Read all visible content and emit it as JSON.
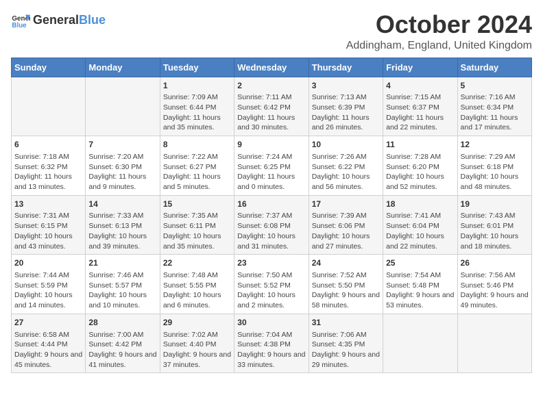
{
  "logo": {
    "general": "General",
    "blue": "Blue"
  },
  "title": {
    "month_year": "October 2024",
    "location": "Addingham, England, United Kingdom"
  },
  "days_header": [
    "Sunday",
    "Monday",
    "Tuesday",
    "Wednesday",
    "Thursday",
    "Friday",
    "Saturday"
  ],
  "weeks": [
    [
      {
        "day": "",
        "info": ""
      },
      {
        "day": "",
        "info": ""
      },
      {
        "day": "1",
        "info": "Sunrise: 7:09 AM\nSunset: 6:44 PM\nDaylight: 11 hours and 35 minutes."
      },
      {
        "day": "2",
        "info": "Sunrise: 7:11 AM\nSunset: 6:42 PM\nDaylight: 11 hours and 30 minutes."
      },
      {
        "day": "3",
        "info": "Sunrise: 7:13 AM\nSunset: 6:39 PM\nDaylight: 11 hours and 26 minutes."
      },
      {
        "day": "4",
        "info": "Sunrise: 7:15 AM\nSunset: 6:37 PM\nDaylight: 11 hours and 22 minutes."
      },
      {
        "day": "5",
        "info": "Sunrise: 7:16 AM\nSunset: 6:34 PM\nDaylight: 11 hours and 17 minutes."
      }
    ],
    [
      {
        "day": "6",
        "info": "Sunrise: 7:18 AM\nSunset: 6:32 PM\nDaylight: 11 hours and 13 minutes."
      },
      {
        "day": "7",
        "info": "Sunrise: 7:20 AM\nSunset: 6:30 PM\nDaylight: 11 hours and 9 minutes."
      },
      {
        "day": "8",
        "info": "Sunrise: 7:22 AM\nSunset: 6:27 PM\nDaylight: 11 hours and 5 minutes."
      },
      {
        "day": "9",
        "info": "Sunrise: 7:24 AM\nSunset: 6:25 PM\nDaylight: 11 hours and 0 minutes."
      },
      {
        "day": "10",
        "info": "Sunrise: 7:26 AM\nSunset: 6:22 PM\nDaylight: 10 hours and 56 minutes."
      },
      {
        "day": "11",
        "info": "Sunrise: 7:28 AM\nSunset: 6:20 PM\nDaylight: 10 hours and 52 minutes."
      },
      {
        "day": "12",
        "info": "Sunrise: 7:29 AM\nSunset: 6:18 PM\nDaylight: 10 hours and 48 minutes."
      }
    ],
    [
      {
        "day": "13",
        "info": "Sunrise: 7:31 AM\nSunset: 6:15 PM\nDaylight: 10 hours and 43 minutes."
      },
      {
        "day": "14",
        "info": "Sunrise: 7:33 AM\nSunset: 6:13 PM\nDaylight: 10 hours and 39 minutes."
      },
      {
        "day": "15",
        "info": "Sunrise: 7:35 AM\nSunset: 6:11 PM\nDaylight: 10 hours and 35 minutes."
      },
      {
        "day": "16",
        "info": "Sunrise: 7:37 AM\nSunset: 6:08 PM\nDaylight: 10 hours and 31 minutes."
      },
      {
        "day": "17",
        "info": "Sunrise: 7:39 AM\nSunset: 6:06 PM\nDaylight: 10 hours and 27 minutes."
      },
      {
        "day": "18",
        "info": "Sunrise: 7:41 AM\nSunset: 6:04 PM\nDaylight: 10 hours and 22 minutes."
      },
      {
        "day": "19",
        "info": "Sunrise: 7:43 AM\nSunset: 6:01 PM\nDaylight: 10 hours and 18 minutes."
      }
    ],
    [
      {
        "day": "20",
        "info": "Sunrise: 7:44 AM\nSunset: 5:59 PM\nDaylight: 10 hours and 14 minutes."
      },
      {
        "day": "21",
        "info": "Sunrise: 7:46 AM\nSunset: 5:57 PM\nDaylight: 10 hours and 10 minutes."
      },
      {
        "day": "22",
        "info": "Sunrise: 7:48 AM\nSunset: 5:55 PM\nDaylight: 10 hours and 6 minutes."
      },
      {
        "day": "23",
        "info": "Sunrise: 7:50 AM\nSunset: 5:52 PM\nDaylight: 10 hours and 2 minutes."
      },
      {
        "day": "24",
        "info": "Sunrise: 7:52 AM\nSunset: 5:50 PM\nDaylight: 9 hours and 58 minutes."
      },
      {
        "day": "25",
        "info": "Sunrise: 7:54 AM\nSunset: 5:48 PM\nDaylight: 9 hours and 53 minutes."
      },
      {
        "day": "26",
        "info": "Sunrise: 7:56 AM\nSunset: 5:46 PM\nDaylight: 9 hours and 49 minutes."
      }
    ],
    [
      {
        "day": "27",
        "info": "Sunrise: 6:58 AM\nSunset: 4:44 PM\nDaylight: 9 hours and 45 minutes."
      },
      {
        "day": "28",
        "info": "Sunrise: 7:00 AM\nSunset: 4:42 PM\nDaylight: 9 hours and 41 minutes."
      },
      {
        "day": "29",
        "info": "Sunrise: 7:02 AM\nSunset: 4:40 PM\nDaylight: 9 hours and 37 minutes."
      },
      {
        "day": "30",
        "info": "Sunrise: 7:04 AM\nSunset: 4:38 PM\nDaylight: 9 hours and 33 minutes."
      },
      {
        "day": "31",
        "info": "Sunrise: 7:06 AM\nSunset: 4:35 PM\nDaylight: 9 hours and 29 minutes."
      },
      {
        "day": "",
        "info": ""
      },
      {
        "day": "",
        "info": ""
      }
    ]
  ]
}
